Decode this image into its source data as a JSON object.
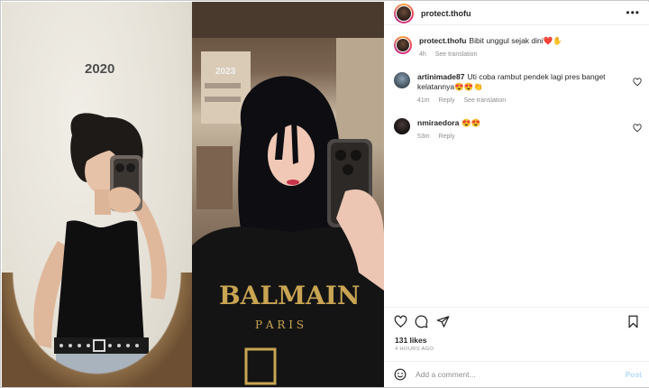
{
  "post": {
    "username": "protect.thofu",
    "image": {
      "left_year": "2020",
      "right_year": "2023"
    }
  },
  "caption": {
    "username": "protect.thofu",
    "text": "Bibit unggul sejak dini❤️✋",
    "time": "4h",
    "see_translation": "See translation"
  },
  "comments": [
    {
      "username": "artinimade87",
      "text": "Uti coba rambut pendek lagi pres banget kelatannya😍😍👏",
      "time": "41m",
      "reply": "Reply",
      "see_translation": "See translation"
    },
    {
      "username": "nmiraedora",
      "text": "😍😍",
      "time": "53m",
      "reply": "Reply"
    }
  ],
  "footer": {
    "likes": "131 likes",
    "time_ago": "4 HOURS AGO",
    "add_comment_placeholder": "Add a comment...",
    "post_label": "Post"
  },
  "icons": {
    "more": "more-horizontal-icon",
    "like": "heart-icon",
    "comment": "comment-bubble-icon",
    "share": "paper-plane-icon",
    "save": "bookmark-icon",
    "emoji": "smiley-icon"
  },
  "colors": {
    "post_button": "#b3dbff",
    "muted_text": "#8e8e8e"
  }
}
